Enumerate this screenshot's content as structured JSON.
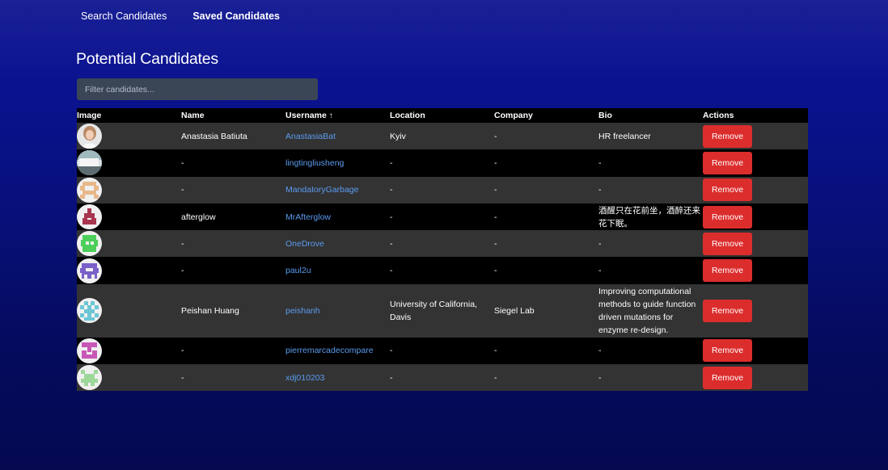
{
  "nav": {
    "search_label": "Search Candidates",
    "saved_label": "Saved Candidates"
  },
  "page_title": "Potential Candidates",
  "filter": {
    "placeholder": "Filter candidates...",
    "value": ""
  },
  "table": {
    "headers": {
      "image": "Image",
      "name": "Name",
      "username": "Username",
      "sort_arrow": "↑",
      "location": "Location",
      "company": "Company",
      "bio": "Bio",
      "actions": "Actions"
    },
    "rows": [
      {
        "avatar": "photo-icon",
        "name": "Anastasia Batiuta",
        "username": "AnastasiaBat",
        "location": "Kyiv",
        "company": "-",
        "bio": "HR freelancer",
        "action": "Remove"
      },
      {
        "avatar": "photo-icon",
        "name": "-",
        "username": "lingtingliusheng",
        "location": "-",
        "company": "-",
        "bio": "-",
        "action": "Remove"
      },
      {
        "avatar": "identicon-peach",
        "name": "-",
        "username": "MandatoryGarbage",
        "location": "-",
        "company": "-",
        "bio": "-",
        "action": "Remove"
      },
      {
        "avatar": "identicon-maroon",
        "name": "afterglow",
        "username": "MrAfterglow",
        "location": "-",
        "company": "-",
        "bio": "酒醒只在花前坐，酒醉还来花下眠。",
        "action": "Remove"
      },
      {
        "avatar": "identicon-green",
        "name": "-",
        "username": "OneDrove",
        "location": "-",
        "company": "-",
        "bio": "-",
        "action": "Remove"
      },
      {
        "avatar": "identicon-purple",
        "name": "-",
        "username": "paul2u",
        "location": "-",
        "company": "-",
        "bio": "-",
        "action": "Remove"
      },
      {
        "avatar": "identicon-cyan",
        "name": "Peishan Huang",
        "username": "peishanh",
        "location": "University of California, Davis",
        "company": "Siegel Lab",
        "bio": "Improving computational methods to guide function driven mutations for enzyme re-design.",
        "action": "Remove"
      },
      {
        "avatar": "identicon-magenta",
        "name": "-",
        "username": "pierremarcadecompare",
        "location": "-",
        "company": "-",
        "bio": "-",
        "action": "Remove"
      },
      {
        "avatar": "identicon-lightgreen",
        "name": "-",
        "username": "xdj010203",
        "location": "-",
        "company": "-",
        "bio": "-",
        "action": "Remove"
      }
    ]
  },
  "colors": {
    "remove_button": "#dc2d2d",
    "username_link": "#5b9bf0",
    "row_odd": "#333333",
    "row_even": "#000000"
  }
}
